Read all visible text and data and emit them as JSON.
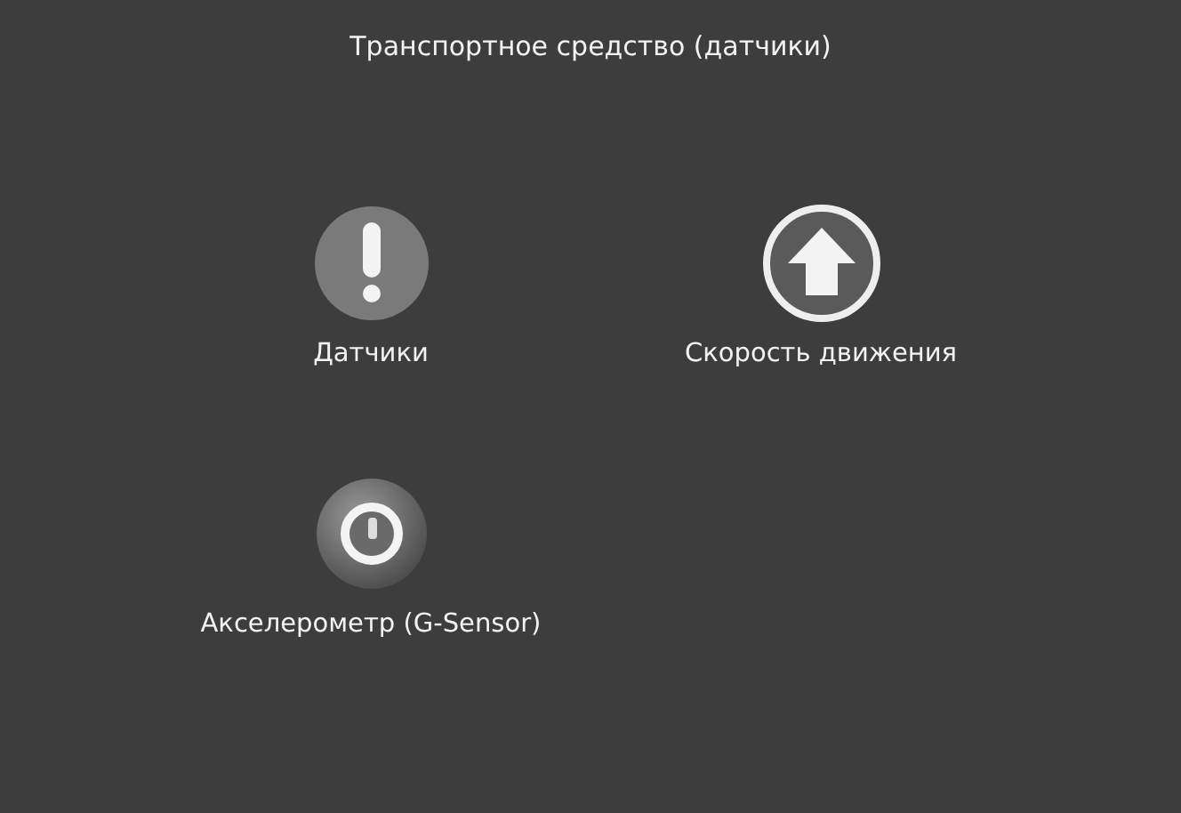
{
  "window": {
    "title": "Транспортное средство (датчики)"
  },
  "items": [
    {
      "kind": "alert",
      "label": "Датчики"
    },
    {
      "kind": "arrow",
      "label": "Скорость движения"
    },
    {
      "kind": "gauge",
      "label": "Акселерометр (G-Sensor)"
    }
  ]
}
